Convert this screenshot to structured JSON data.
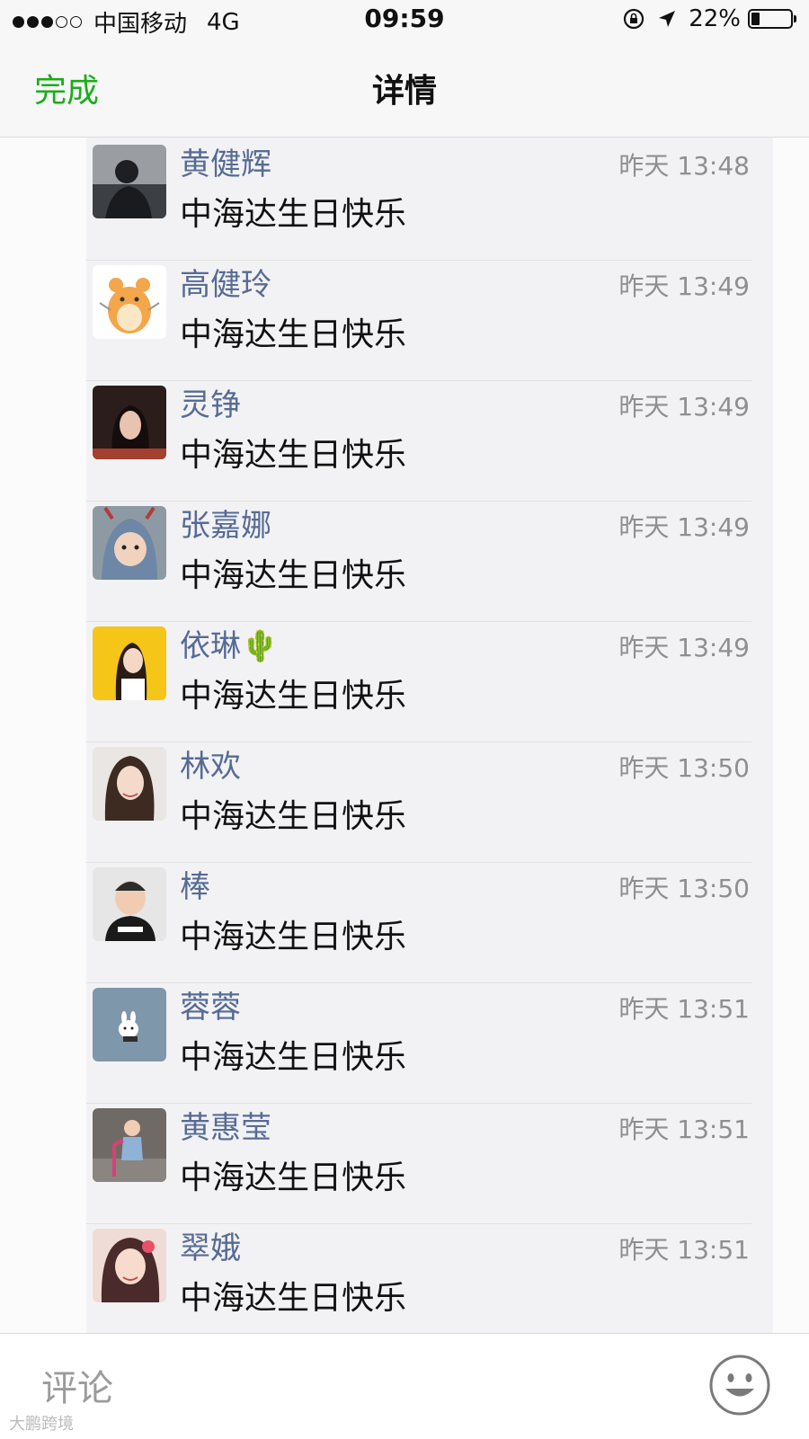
{
  "status_bar": {
    "carrier": "中国移动",
    "network": "4G",
    "time": "09:59",
    "battery": "22%",
    "battery_level": 0.22
  },
  "nav": {
    "done": "完成",
    "title": "详情"
  },
  "comments": [
    {
      "name": "黄健辉",
      "time": "昨天 13:48",
      "text": "中海达生日快乐"
    },
    {
      "name": "高健玲",
      "time": "昨天 13:49",
      "text": "中海达生日快乐"
    },
    {
      "name": "灵铮",
      "time": "昨天 13:49",
      "text": "中海达生日快乐"
    },
    {
      "name": "张嘉娜",
      "time": "昨天 13:49",
      "text": "中海达生日快乐"
    },
    {
      "name": "依琳🌵",
      "time": "昨天 13:49",
      "text": "中海达生日快乐"
    },
    {
      "name": "林欢",
      "time": "昨天 13:50",
      "text": "中海达生日快乐"
    },
    {
      "name": "棒",
      "time": "昨天 13:50",
      "text": "中海达生日快乐"
    },
    {
      "name": "蓉蓉",
      "time": "昨天 13:51",
      "text": "中海达生日快乐"
    },
    {
      "name": "黄惠莹",
      "time": "昨天 13:51",
      "text": "中海达生日快乐"
    },
    {
      "name": "翠娥",
      "time": "昨天 13:51",
      "text": "中海达生日快乐"
    }
  ],
  "comment_bar": {
    "placeholder": "评论",
    "emoji_icon": "smiley-face-icon"
  },
  "watermark": "大鹏跨境",
  "colors": {
    "accent_green": "#1aad19",
    "name_blue": "#576b95"
  }
}
